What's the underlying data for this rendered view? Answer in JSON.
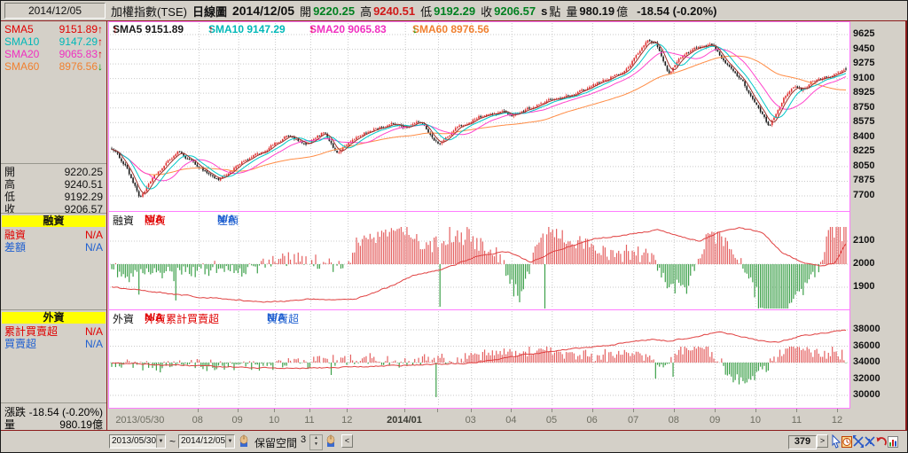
{
  "window": {
    "date_box": "2014/12/05"
  },
  "header": {
    "title": "加權指數(TSE)",
    "period": "日線圖",
    "date": "2014/12/05",
    "open_label": "開",
    "open": "9220.25",
    "high_label": "高",
    "high": "9240.51",
    "low_label": "低",
    "low": "9192.29",
    "close_label": "收",
    "close": "9206.57",
    "close_suffix": "s",
    "point_label": "點",
    "volume_label": "量",
    "volume": "980.19",
    "volume_unit": "億",
    "change": "-18.54 (-0.20%)"
  },
  "sidebar": {
    "sma_rows": [
      {
        "label": "SMA5",
        "value": "9151.89",
        "arrow": "↑",
        "color": "#e00000",
        "arrow_color": "#e00000"
      },
      {
        "label": "SMA10",
        "value": "9147.29",
        "arrow": "↑",
        "color": "#00b8b8",
        "arrow_color": "#e00000"
      },
      {
        "label": "SMA20",
        "value": "9065.83",
        "arrow": "↑",
        "color": "#f030c0",
        "arrow_color": "#e00000"
      },
      {
        "label": "SMA60",
        "value": "8976.56",
        "arrow": "↓",
        "color": "#f08030",
        "arrow_color": "#00a000"
      }
    ],
    "ohlc_rows": [
      {
        "label": "開",
        "value": "9220.25"
      },
      {
        "label": "高",
        "value": "9240.51"
      },
      {
        "label": "低",
        "value": "9192.29"
      },
      {
        "label": "收",
        "value": "9206.57"
      }
    ],
    "margin_header": "融資",
    "margin_rows": [
      {
        "label": "融資",
        "value": "N/A",
        "color": "#e00000"
      },
      {
        "label": "差額",
        "value": "N/A",
        "color": "#2060d0"
      }
    ],
    "foreign_header": "外資",
    "foreign_rows": [
      {
        "label": "累計買賣超",
        "value": "N/A",
        "color": "#e00000"
      },
      {
        "label": "買賣超",
        "value": "N/A",
        "color": "#2060d0"
      }
    ],
    "change_label": "漲跌",
    "change_value": "-18.54 (-0.20%)",
    "vol_label": "量",
    "vol_value": "980.19億"
  },
  "price_panel": {
    "sma_header": [
      {
        "label": "SMA5",
        "value": "9151.89",
        "arrow": "↑",
        "color": "#1a1a1a",
        "arrow_color": "#e00000",
        "x": 4
      },
      {
        "label": "SMA10",
        "value": "9147.29",
        "arrow": "↑",
        "color": "#00b8b8",
        "arrow_color": "#e00000",
        "x": 112
      },
      {
        "label": "SMA20",
        "value": "9065.83",
        "arrow": "↑",
        "color": "#f030c0",
        "arrow_color": "#e00000",
        "x": 226
      },
      {
        "label": "SMA60",
        "value": "8976.56",
        "arrow": "↓",
        "color": "#f08030",
        "arrow_color": "#00a000",
        "x": 342
      }
    ],
    "y_labels": [
      "9625",
      "9450",
      "9275",
      "9100",
      "8925",
      "8750",
      "8575",
      "8400",
      "8225",
      "8050",
      "7875",
      "7700"
    ]
  },
  "margin_panel": {
    "title": "融資",
    "rows": [
      {
        "label": "融資",
        "value": "N/A",
        "color": "#e00000",
        "x": 40
      },
      {
        "label": "差額",
        "value": "N/A",
        "color": "#2060d0",
        "x": 122
      }
    ],
    "y_labels": [
      "2100",
      "2000",
      "1900"
    ]
  },
  "foreign_panel": {
    "title": "外資",
    "rows": [
      {
        "label": "外資累計買賣超",
        "value": "N/A",
        "color": "#e00000",
        "x": 40
      },
      {
        "label": "買賣超",
        "value": "N/A",
        "color": "#2060d0",
        "x": 178
      }
    ],
    "y_labels": [
      "38000",
      "36000",
      "34000",
      "32000",
      "30000"
    ]
  },
  "x_axis": [
    {
      "label": "2013/05/30",
      "t": 0.004,
      "align": "left"
    },
    {
      "label": "08",
      "t": 0.119
    },
    {
      "label": "09",
      "t": 0.173
    },
    {
      "label": "10",
      "t": 0.223
    },
    {
      "label": "11",
      "t": 0.271
    },
    {
      "label": "12",
      "t": 0.322
    },
    {
      "label": "2014/01",
      "t": 0.4,
      "bold": true
    },
    {
      "label": "",
      "t": 0.445
    },
    {
      "label": "03",
      "t": 0.49
    },
    {
      "label": "04",
      "t": 0.545
    },
    {
      "label": "05",
      "t": 0.6
    },
    {
      "label": "06",
      "t": 0.655
    },
    {
      "label": "07",
      "t": 0.711
    },
    {
      "label": "08",
      "t": 0.766
    },
    {
      "label": "09",
      "t": 0.822
    },
    {
      "label": "10",
      "t": 0.877
    },
    {
      "label": "11",
      "t": 0.933
    },
    {
      "label": "12",
      "t": 0.988
    }
  ],
  "bottom_bar": {
    "from_date": "2013/05/30",
    "separator": "~",
    "to_date": "2014/12/05",
    "reserve_label": "保留空間",
    "reserve_value": "3",
    "scroll_left": "<",
    "scroll_right": ">",
    "bar_count": "379",
    "icons": [
      "hand-icon",
      "spinner-control",
      "hand-icon",
      "pointer-icon",
      "clock-icon",
      "expand-icon",
      "shrink-icon",
      "undo-icon",
      "chart-icon",
      "clipboard-icon"
    ]
  },
  "chart_data": {
    "type": "candlestick",
    "bar_count": 379,
    "price": {
      "y_range": [
        7700,
        9625
      ],
      "grid_step": 175,
      "close_keypoints": [
        [
          0,
          8270
        ],
        [
          0.02,
          8050
        ],
        [
          0.038,
          7680
        ],
        [
          0.06,
          7950
        ],
        [
          0.09,
          8230
        ],
        [
          0.11,
          8100
        ],
        [
          0.145,
          7890
        ],
        [
          0.175,
          8080
        ],
        [
          0.21,
          8250
        ],
        [
          0.24,
          8420
        ],
        [
          0.265,
          8300
        ],
        [
          0.29,
          8470
        ],
        [
          0.306,
          8210
        ],
        [
          0.33,
          8380
        ],
        [
          0.358,
          8500
        ],
        [
          0.386,
          8560
        ],
        [
          0.4,
          8520
        ],
        [
          0.42,
          8590
        ],
        [
          0.446,
          8310
        ],
        [
          0.47,
          8510
        ],
        [
          0.5,
          8640
        ],
        [
          0.53,
          8700
        ],
        [
          0.545,
          8670
        ],
        [
          0.57,
          8750
        ],
        [
          0.6,
          8850
        ],
        [
          0.63,
          8900
        ],
        [
          0.65,
          8990
        ],
        [
          0.68,
          9120
        ],
        [
          0.7,
          9190
        ],
        [
          0.73,
          9560
        ],
        [
          0.742,
          9510
        ],
        [
          0.758,
          9160
        ],
        [
          0.775,
          9350
        ],
        [
          0.79,
          9440
        ],
        [
          0.815,
          9520
        ],
        [
          0.835,
          9310
        ],
        [
          0.86,
          9050
        ],
        [
          0.88,
          8750
        ],
        [
          0.896,
          8520
        ],
        [
          0.915,
          8870
        ],
        [
          0.928,
          9020
        ],
        [
          0.94,
          8950
        ],
        [
          0.955,
          9080
        ],
        [
          0.97,
          9120
        ],
        [
          0.985,
          9140
        ],
        [
          1,
          9206.57
        ]
      ],
      "last_candle": {
        "open": 9220.25,
        "high": 9240.51,
        "low": 9192.29,
        "close": 9206.57
      },
      "sma_periods": [
        5,
        10,
        20,
        60
      ]
    },
    "margin": {
      "y_ticks": [
        2100,
        2000,
        1900
      ],
      "bar_baseline": 2000,
      "line_keypoints": [
        [
          0,
          1900
        ],
        [
          0.06,
          1878
        ],
        [
          0.12,
          1858
        ],
        [
          0.21,
          1835
        ],
        [
          0.27,
          1848
        ],
        [
          0.33,
          1845
        ],
        [
          0.38,
          1905
        ],
        [
          0.41,
          1950
        ],
        [
          0.448,
          1975
        ],
        [
          0.5,
          2035
        ],
        [
          0.54,
          2055
        ],
        [
          0.57,
          2008
        ],
        [
          0.61,
          2065
        ],
        [
          0.66,
          2112
        ],
        [
          0.71,
          2131
        ],
        [
          0.745,
          2150
        ],
        [
          0.77,
          2125
        ],
        [
          0.8,
          2100
        ],
        [
          0.825,
          2135
        ],
        [
          0.854,
          2158
        ],
        [
          0.885,
          2140
        ],
        [
          0.912,
          2054
        ],
        [
          0.938,
          2012
        ],
        [
          0.965,
          1992
        ],
        [
          0.985,
          2005
        ],
        [
          1,
          2090
        ]
      ],
      "bar_spikes": [
        [
          0.448,
          -48
        ],
        [
          0.59,
          -55
        ],
        [
          0.44,
          30
        ],
        [
          0.985,
          30
        ],
        [
          0.995,
          26
        ]
      ]
    },
    "foreign": {
      "y_ticks": [
        38000,
        36000,
        34000,
        32000,
        30000
      ],
      "bar_baseline": 34000,
      "line_keypoints": [
        [
          0,
          33900
        ],
        [
          0.08,
          33700
        ],
        [
          0.15,
          33500
        ],
        [
          0.22,
          33320
        ],
        [
          0.28,
          33350
        ],
        [
          0.34,
          33500
        ],
        [
          0.4,
          33680
        ],
        [
          0.45,
          33800
        ],
        [
          0.478,
          33900
        ],
        [
          0.52,
          34300
        ],
        [
          0.56,
          34900
        ],
        [
          0.61,
          35500
        ],
        [
          0.68,
          36160
        ],
        [
          0.735,
          36840
        ],
        [
          0.76,
          36620
        ],
        [
          0.795,
          37130
        ],
        [
          0.824,
          37730
        ],
        [
          0.852,
          37350
        ],
        [
          0.88,
          36700
        ],
        [
          0.908,
          36490
        ],
        [
          0.94,
          37240
        ],
        [
          0.97,
          37600
        ],
        [
          1,
          37950
        ]
      ],
      "bar_spikes": [
        [
          0.442,
          -39
        ],
        [
          0.3,
          -14
        ],
        [
          0.74,
          -18
        ],
        [
          0.765,
          -16
        ]
      ]
    }
  },
  "colors": {
    "up": "#e03030",
    "down": "#1a1a1a",
    "sma5": "#9c2f28",
    "sma10": "#00c8c8",
    "sma20": "#ff44cc",
    "sma60": "#ff8c45",
    "panel_border": "#ff7cff",
    "bar_red": "#e46060",
    "bar_green": "#3da04a",
    "line_red": "#e04040",
    "grid": "#c9c9c9",
    "section_yellow": "#ffff00"
  }
}
